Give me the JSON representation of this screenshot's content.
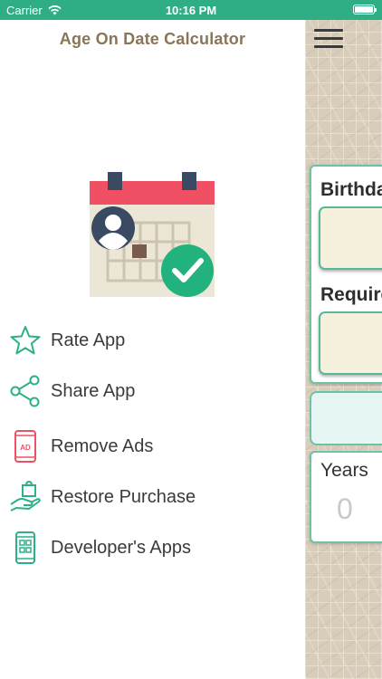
{
  "status_bar": {
    "carrier": "Carrier",
    "time": "10:16 PM"
  },
  "drawer": {
    "title": "Age On Date Calculator",
    "menu": [
      {
        "label": "Rate App",
        "icon": "star-icon"
      },
      {
        "label": "Share App",
        "icon": "share-icon"
      },
      {
        "label": "Remove Ads",
        "icon": "remove-ads-icon"
      },
      {
        "label": "Restore Purchase",
        "icon": "restore-purchase-icon"
      },
      {
        "label": "Developer's Apps",
        "icon": "developer-apps-icon"
      }
    ]
  },
  "main": {
    "birthday_label": "Birthday",
    "required_label": "Required",
    "years_label": "Years",
    "years_value": "0"
  },
  "colors": {
    "status_bar": "#2fae86",
    "accent": "#3dbd9a",
    "title": "#8a7656"
  }
}
